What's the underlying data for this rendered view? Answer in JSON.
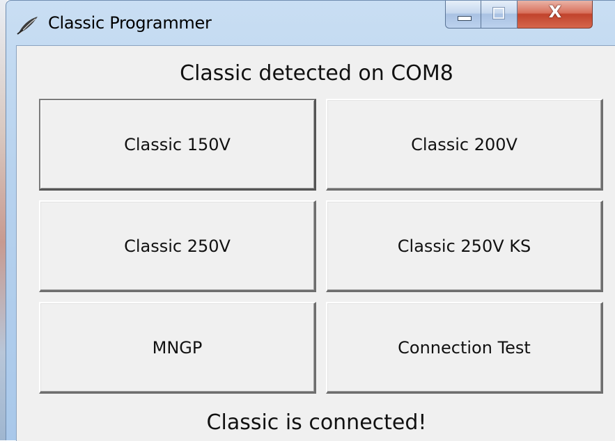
{
  "window": {
    "title": "Classic Programmer",
    "icon": "feather-app-icon",
    "caption_buttons": {
      "minimize_icon": "minimize-icon",
      "maximize_icon": "maximize-icon",
      "close_label": "X"
    }
  },
  "main": {
    "header": "Classic detected on COM8",
    "buttons": [
      {
        "label": "Classic 150V"
      },
      {
        "label": "Classic 200V"
      },
      {
        "label": "Classic 250V"
      },
      {
        "label": "Classic 250V KS"
      },
      {
        "label": "MNGP"
      },
      {
        "label": "Connection Test"
      }
    ],
    "footer": "Classic is connected!"
  },
  "colors": {
    "client_bg": "#f0f0f0",
    "titlebar": "#b7d2ee",
    "close_button": "#c1432c"
  }
}
